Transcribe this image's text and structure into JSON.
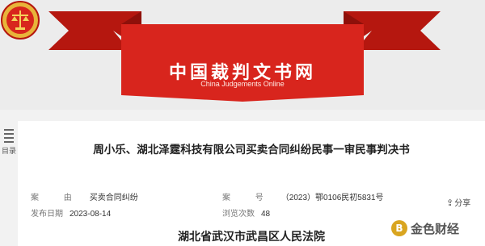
{
  "header": {
    "site_title": "中国裁判文书网",
    "site_subtitle": "China Judgements Online"
  },
  "toc": {
    "label": "目录"
  },
  "document": {
    "title": "周小乐、湖北泽霆科技有限公司买卖合同纠纷民事一审民事判决书",
    "case_cause_key": "案 由",
    "case_cause_value": "买卖合同纠纷",
    "case_number_key": "案 号",
    "case_number_value": "（2023）鄂0106民初5831号",
    "publish_date_key": "发布日期",
    "publish_date_value": "2023-08-14",
    "views_key": "浏览次数",
    "views_value": "48",
    "share_label": "分享",
    "court_name": "湖北省武汉市武昌区人民法院"
  },
  "watermark": {
    "logo_char": "B",
    "text": "金色财经"
  },
  "colors": {
    "banner_red": "#d8251d",
    "banner_dark": "#a9150f"
  }
}
